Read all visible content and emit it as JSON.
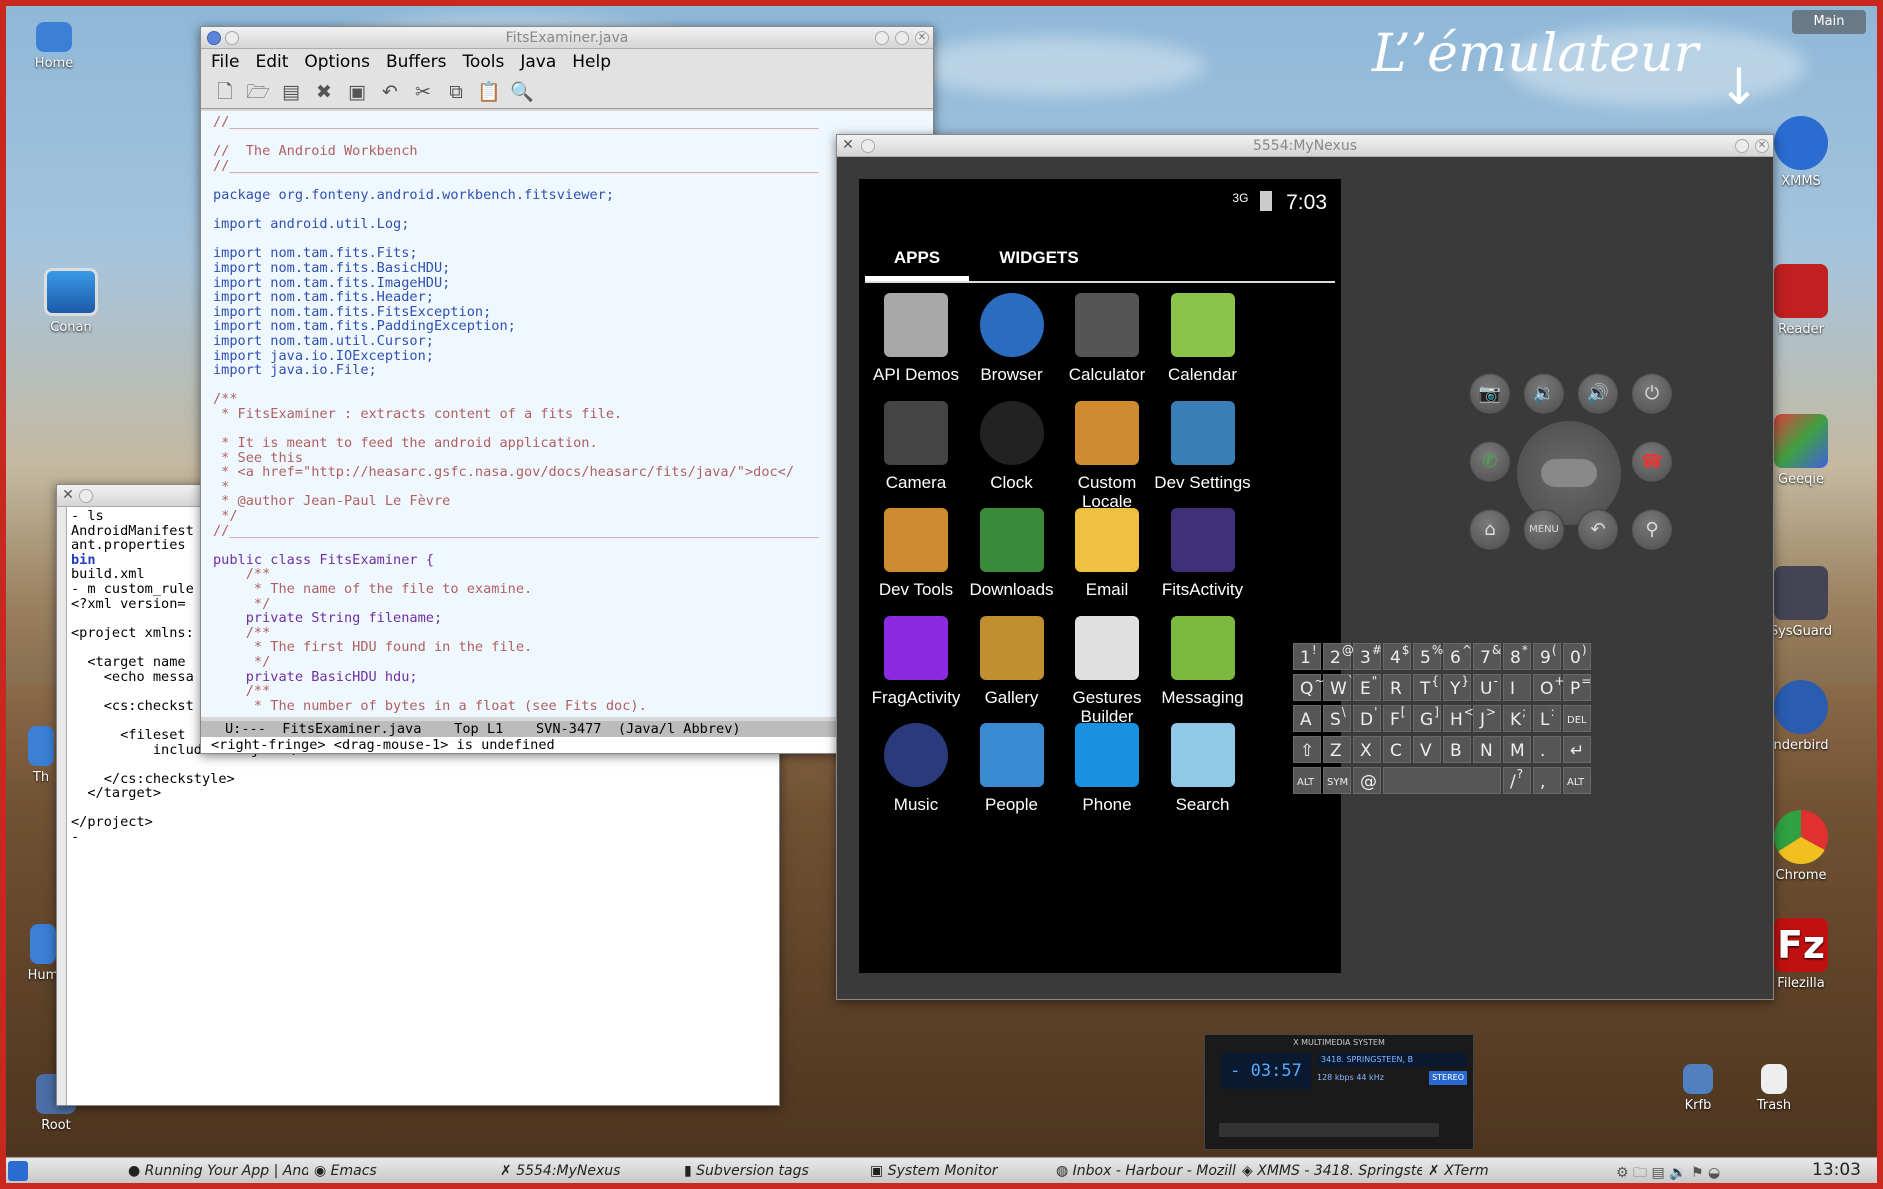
{
  "desktop": {
    "annotation": "L’’émulateur",
    "icons": [
      {
        "label": "Home"
      },
      {
        "label": "Conan"
      },
      {
        "label": "Root"
      },
      {
        "label": "XMMS"
      },
      {
        "label": "Reader"
      },
      {
        "label": "Geeqie"
      },
      {
        "label": "SysGuard"
      },
      {
        "label": "nderbird"
      },
      {
        "label": "Chrome"
      },
      {
        "label": "Filezilla"
      },
      {
        "label": "Krfb"
      },
      {
        "label": "Trash"
      },
      {
        "label": "Th"
      },
      {
        "label": "Hum"
      }
    ],
    "main_label": "Main"
  },
  "emacs": {
    "title": "FitsExaminer.java",
    "menu": [
      "File",
      "Edit",
      "Options",
      "Buffers",
      "Tools",
      "Java",
      "Help"
    ],
    "lines": [
      "//________________________________________________________________________",
      "",
      "//  The Android Workbench",
      "//________________________________________________________________________",
      "",
      "package org.fonteny.android.workbench.fitsviewer;",
      "",
      "import android.util.Log;",
      "",
      "import nom.tam.fits.Fits;",
      "import nom.tam.fits.BasicHDU;",
      "import nom.tam.fits.ImageHDU;",
      "import nom.tam.fits.Header;",
      "import nom.tam.fits.FitsException;",
      "import nom.tam.fits.PaddingException;",
      "import nom.tam.util.Cursor;",
      "import java.io.IOException;",
      "import java.io.File;",
      "",
      "/**",
      " * FitsExaminer : extracts content of a fits file.",
      "",
      " * It is meant to feed the android application.",
      " * See this",
      " * <a href=\"http://heasarc.gsfc.nasa.gov/docs/heasarc/fits/java/\">doc</",
      " *",
      " * @author Jean-Paul Le Fèvre",
      " */",
      "//________________________________________________________________________",
      "",
      "public class FitsExaminer {",
      "    /**",
      "     * The name of the file to examine.",
      "     */",
      "    private String filename;",
      "    /**",
      "     * The first HDU found in the file.",
      "     */",
      "    private BasicHDU hdu;",
      "    /**",
      "     * The number of bytes in a float (see Fits doc)."
    ],
    "modeline": "U:---  FitsExaminer.java    Top L1    SVN-3477  (Java/l Abbrev)",
    "minibuffer": "<right-fringe> <drag-mouse-1> is undefined"
  },
  "xterm": {
    "lines": [
      "- ls",
      "AndroidManifest",
      "ant.properties",
      "bin",
      "build.xml",
      "- m custom_rule",
      "<?xml version=",
      "",
      "<project xmlns:",
      "",
      "  <target name",
      "    <echo messa",
      "",
      "    <cs:checkst",
      "",
      "      <fileset",
      "          includes=\"*.java\"/>",
      "",
      "    </cs:checkstyle>",
      "  </target>",
      "",
      "</project>",
      "- "
    ]
  },
  "emulator": {
    "title": "5554:MyNexus",
    "status": {
      "network": "3G",
      "time": "7:03"
    },
    "tabs": [
      "APPS",
      "WIDGETS"
    ],
    "apps": [
      {
        "label": "API Demos",
        "icon": "api-demos-icon",
        "color": "#a8a8a8"
      },
      {
        "label": "Browser",
        "icon": "browser-icon",
        "color": "#2a6cc0"
      },
      {
        "label": "Calculator",
        "icon": "calculator-icon",
        "color": "#555555"
      },
      {
        "label": "Calendar",
        "icon": "calendar-icon",
        "color": "#8cc34a"
      },
      {
        "label": "Camera",
        "icon": "camera-icon",
        "color": "#444444"
      },
      {
        "label": "Clock",
        "icon": "clock-icon",
        "color": "#222222"
      },
      {
        "label": "Custom\nLocale",
        "icon": "custom-locale-icon",
        "color": "#d08a30"
      },
      {
        "label": "Dev Settings",
        "icon": "dev-settings-icon",
        "color": "#3a7fb8"
      },
      {
        "label": "Dev Tools",
        "icon": "dev-tools-icon",
        "color": "#d08a30"
      },
      {
        "label": "Downloads",
        "icon": "downloads-icon",
        "color": "#3a8a3a"
      },
      {
        "label": "Email",
        "icon": "email-icon",
        "color": "#f0c040"
      },
      {
        "label": "FitsActivity",
        "icon": "fits-activity-icon",
        "color": "#40307a"
      },
      {
        "label": "FragActivity",
        "icon": "frag-activity-icon",
        "color": "#8a2be2"
      },
      {
        "label": "Gallery",
        "icon": "gallery-icon",
        "color": "#c09030"
      },
      {
        "label": "Gestures\nBuilder",
        "icon": "gestures-builder-icon",
        "color": "#e0e0e0"
      },
      {
        "label": "Messaging",
        "icon": "messaging-icon",
        "color": "#7ab840"
      },
      {
        "label": "Music",
        "icon": "music-icon",
        "color": "#2a3a7a"
      },
      {
        "label": "People",
        "icon": "people-icon",
        "color": "#3a8ad0"
      },
      {
        "label": "Phone",
        "icon": "phone-icon",
        "color": "#1a90e0"
      },
      {
        "label": "Search",
        "icon": "search-icon",
        "color": "#90c8e8"
      }
    ],
    "hw_buttons": [
      "camera",
      "volume-down",
      "volume-up",
      "power",
      "call",
      "end-call",
      "home",
      "menu",
      "back",
      "search"
    ],
    "keyboard": [
      [
        "1|!",
        "2|@",
        "3|#",
        "4|$",
        "5|%",
        "6|^",
        "7|&",
        "8|*",
        "9|(",
        "0|)"
      ],
      [
        "Q|~",
        "W|`",
        "E|\"",
        "R|",
        "T|{",
        "Y|}",
        "U|-",
        "I|",
        "O|+",
        "P|="
      ],
      [
        "A|",
        "S|\\",
        "D|'",
        "F|[",
        "G|]",
        "H|<",
        "J|>",
        "K|;",
        "L|:",
        "DEL|"
      ],
      [
        "⇧|",
        "Z|",
        "X|",
        "C|",
        "V|",
        "B|",
        "N|",
        "M|",
        ".|",
        "↵|"
      ],
      [
        "ALT|",
        "SYM|",
        "@|",
        "␣|",
        "/|?",
        ",|",
        "ALT|"
      ]
    ]
  },
  "xmms": {
    "title": "X MULTIMEDIA SYSTEM",
    "time": "- 03:57",
    "track": "3418. SPRINGSTEEN, B",
    "kbps": "128",
    "khz": "44",
    "stereo": "STEREO"
  },
  "taskbar": {
    "tasks": [
      "Running Your App | Andr",
      "Emacs",
      "5554:MyNexus",
      "Subversion tags",
      "System Monitor",
      "Inbox - Harbour - Mozill",
      "XMMS - 3418. Springstee",
      "XTerm"
    ],
    "clock": "13:03"
  }
}
